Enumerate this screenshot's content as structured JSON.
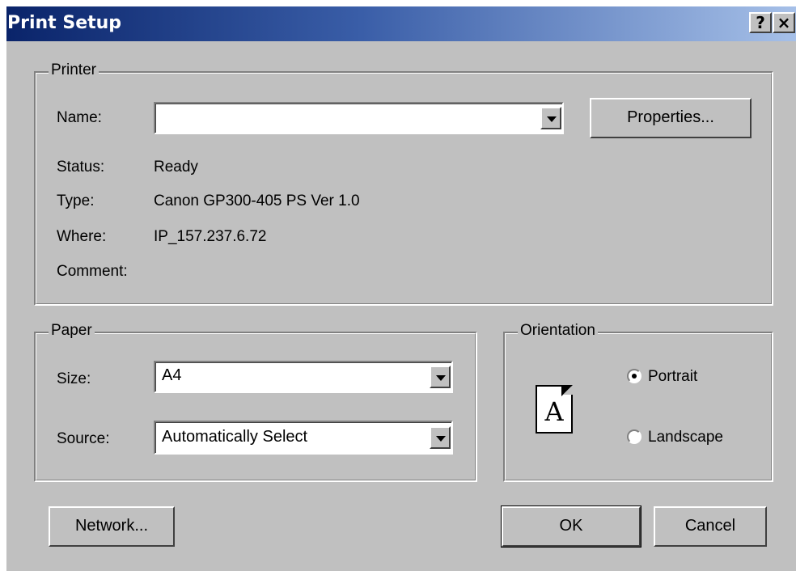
{
  "window": {
    "title": "Print Setup"
  },
  "titlebar": {
    "help_label": "?",
    "close_label": "×"
  },
  "printer_group": {
    "legend": "Printer",
    "name_label": "Name:",
    "name_value": "",
    "properties_button": "Properties...",
    "status_label": "Status:",
    "status_value": "Ready",
    "type_label": "Type:",
    "type_value": "Canon GP300-405 PS Ver 1.0",
    "where_label": "Where:",
    "where_value": "IP_157.237.6.72",
    "comment_label": "Comment:",
    "comment_value": ""
  },
  "paper_group": {
    "legend": "Paper",
    "size_label": "Size:",
    "size_value": "A4",
    "source_label": "Source:",
    "source_value": "Automatically Select"
  },
  "orientation_group": {
    "legend": "Orientation",
    "icon_letter": "A",
    "portrait_label": "Portrait",
    "landscape_label": "Landscape",
    "selected": "Portrait"
  },
  "buttons": {
    "network": "Network...",
    "ok": "OK",
    "cancel": "Cancel"
  },
  "icons": {
    "dropdown": "chevron-down-icon",
    "help": "help-icon",
    "close": "close-icon",
    "page": "portrait-page-icon"
  }
}
